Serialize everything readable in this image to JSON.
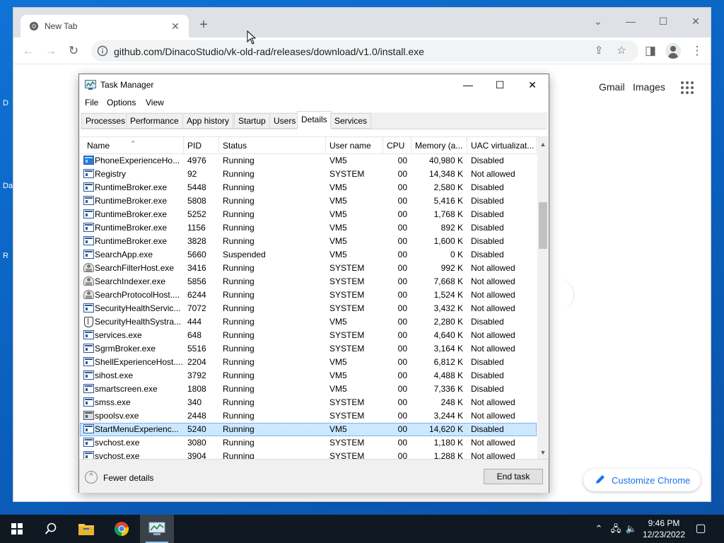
{
  "desktop": {
    "fragments": [
      "D",
      "Da",
      "R"
    ]
  },
  "browser": {
    "tab": {
      "title": "New Tab",
      "close": "✕"
    },
    "new_tab": "+",
    "window_controls": {
      "menu": "⌄",
      "minimize": "—",
      "maximize": "☐",
      "close": "✕"
    },
    "nav": {
      "back": "←",
      "forward": "→",
      "reload": "↻"
    },
    "url": "github.com/DinacoStudio/vk-old-rad/releases/download/v1.0/install.exe",
    "omnibox_icons": {
      "share": "⇪",
      "bookmark": "☆"
    },
    "side_panel": "◨",
    "menu": "⋮",
    "ntp": {
      "gmail": "Gmail",
      "images": "Images",
      "customize": "Customize Chrome"
    }
  },
  "task_manager": {
    "title": "Task Manager",
    "window_controls": {
      "minimize": "—",
      "maximize": "☐",
      "close": "✕"
    },
    "menu": [
      "File",
      "Options",
      "View"
    ],
    "tabs": [
      "Processes",
      "Performance",
      "App history",
      "Startup",
      "Users",
      "Details",
      "Services"
    ],
    "active_tab": "Details",
    "columns": [
      "Name",
      "PID",
      "Status",
      "User name",
      "CPU",
      "Memory (a...",
      "UAC virtualizat..."
    ],
    "sort_indicator": "^",
    "rows": [
      {
        "icon": "phone",
        "name": "PhoneExperienceHo...",
        "pid": "4976",
        "status": "Running",
        "user": "VM5",
        "cpu": "00",
        "mem": "40,980 K",
        "uac": "Disabled"
      },
      {
        "icon": "app",
        "name": "Registry",
        "pid": "92",
        "status": "Running",
        "user": "SYSTEM",
        "cpu": "00",
        "mem": "14,348 K",
        "uac": "Not allowed"
      },
      {
        "icon": "app",
        "name": "RuntimeBroker.exe",
        "pid": "5448",
        "status": "Running",
        "user": "VM5",
        "cpu": "00",
        "mem": "2,580 K",
        "uac": "Disabled"
      },
      {
        "icon": "app",
        "name": "RuntimeBroker.exe",
        "pid": "5808",
        "status": "Running",
        "user": "VM5",
        "cpu": "00",
        "mem": "5,416 K",
        "uac": "Disabled"
      },
      {
        "icon": "app",
        "name": "RuntimeBroker.exe",
        "pid": "5252",
        "status": "Running",
        "user": "VM5",
        "cpu": "00",
        "mem": "1,768 K",
        "uac": "Disabled"
      },
      {
        "icon": "app",
        "name": "RuntimeBroker.exe",
        "pid": "1156",
        "status": "Running",
        "user": "VM5",
        "cpu": "00",
        "mem": "892 K",
        "uac": "Disabled"
      },
      {
        "icon": "app",
        "name": "RuntimeBroker.exe",
        "pid": "3828",
        "status": "Running",
        "user": "VM5",
        "cpu": "00",
        "mem": "1,600 K",
        "uac": "Disabled"
      },
      {
        "icon": "app",
        "name": "SearchApp.exe",
        "pid": "5660",
        "status": "Suspended",
        "user": "VM5",
        "cpu": "00",
        "mem": "0 K",
        "uac": "Disabled"
      },
      {
        "icon": "person",
        "name": "SearchFilterHost.exe",
        "pid": "3416",
        "status": "Running",
        "user": "SYSTEM",
        "cpu": "00",
        "mem": "992 K",
        "uac": "Not allowed"
      },
      {
        "icon": "person",
        "name": "SearchIndexer.exe",
        "pid": "5856",
        "status": "Running",
        "user": "SYSTEM",
        "cpu": "00",
        "mem": "7,668 K",
        "uac": "Not allowed"
      },
      {
        "icon": "person",
        "name": "SearchProtocolHost....",
        "pid": "6244",
        "status": "Running",
        "user": "SYSTEM",
        "cpu": "00",
        "mem": "1,524 K",
        "uac": "Not allowed"
      },
      {
        "icon": "app",
        "name": "SecurityHealthServic...",
        "pid": "7072",
        "status": "Running",
        "user": "SYSTEM",
        "cpu": "00",
        "mem": "3,432 K",
        "uac": "Not allowed"
      },
      {
        "icon": "shield",
        "name": "SecurityHealthSystra...",
        "pid": "444",
        "status": "Running",
        "user": "VM5",
        "cpu": "00",
        "mem": "2,280 K",
        "uac": "Disabled"
      },
      {
        "icon": "app",
        "name": "services.exe",
        "pid": "648",
        "status": "Running",
        "user": "SYSTEM",
        "cpu": "00",
        "mem": "4,640 K",
        "uac": "Not allowed"
      },
      {
        "icon": "app",
        "name": "SgrmBroker.exe",
        "pid": "5516",
        "status": "Running",
        "user": "SYSTEM",
        "cpu": "00",
        "mem": "3,164 K",
        "uac": "Not allowed"
      },
      {
        "icon": "app",
        "name": "ShellExperienceHost....",
        "pid": "2204",
        "status": "Running",
        "user": "VM5",
        "cpu": "00",
        "mem": "6,812 K",
        "uac": "Disabled"
      },
      {
        "icon": "app",
        "name": "sihost.exe",
        "pid": "3792",
        "status": "Running",
        "user": "VM5",
        "cpu": "00",
        "mem": "4,488 K",
        "uac": "Disabled"
      },
      {
        "icon": "app",
        "name": "smartscreen.exe",
        "pid": "1808",
        "status": "Running",
        "user": "VM5",
        "cpu": "00",
        "mem": "7,336 K",
        "uac": "Disabled"
      },
      {
        "icon": "app",
        "name": "smss.exe",
        "pid": "340",
        "status": "Running",
        "user": "SYSTEM",
        "cpu": "00",
        "mem": "248 K",
        "uac": "Not allowed"
      },
      {
        "icon": "printer",
        "name": "spoolsv.exe",
        "pid": "2448",
        "status": "Running",
        "user": "SYSTEM",
        "cpu": "00",
        "mem": "3,244 K",
        "uac": "Not allowed"
      },
      {
        "icon": "app",
        "name": "StartMenuExperienc...",
        "pid": "5240",
        "status": "Running",
        "user": "VM5",
        "cpu": "00",
        "mem": "14,620 K",
        "uac": "Disabled",
        "selected": true
      },
      {
        "icon": "app",
        "name": "svchost.exe",
        "pid": "3080",
        "status": "Running",
        "user": "SYSTEM",
        "cpu": "00",
        "mem": "1,180 K",
        "uac": "Not allowed"
      },
      {
        "icon": "app",
        "name": "svchost.exe",
        "pid": "3904",
        "status": "Running",
        "user": "SYSTEM",
        "cpu": "00",
        "mem": "1,288 K",
        "uac": "Not allowed"
      }
    ],
    "scroll_arrows": {
      "up": "▲",
      "down": "▼"
    },
    "footer": {
      "fewer_icon": "^",
      "fewer_details": "Fewer details",
      "end_task": "End task"
    }
  },
  "taskbar": {
    "search_icon": "⚲",
    "tray": {
      "chevron": "⌃",
      "network": "🖧",
      "volume": "🔈"
    },
    "time": "9:46 PM",
    "date": "12/23/2022",
    "notifications": "▢"
  }
}
